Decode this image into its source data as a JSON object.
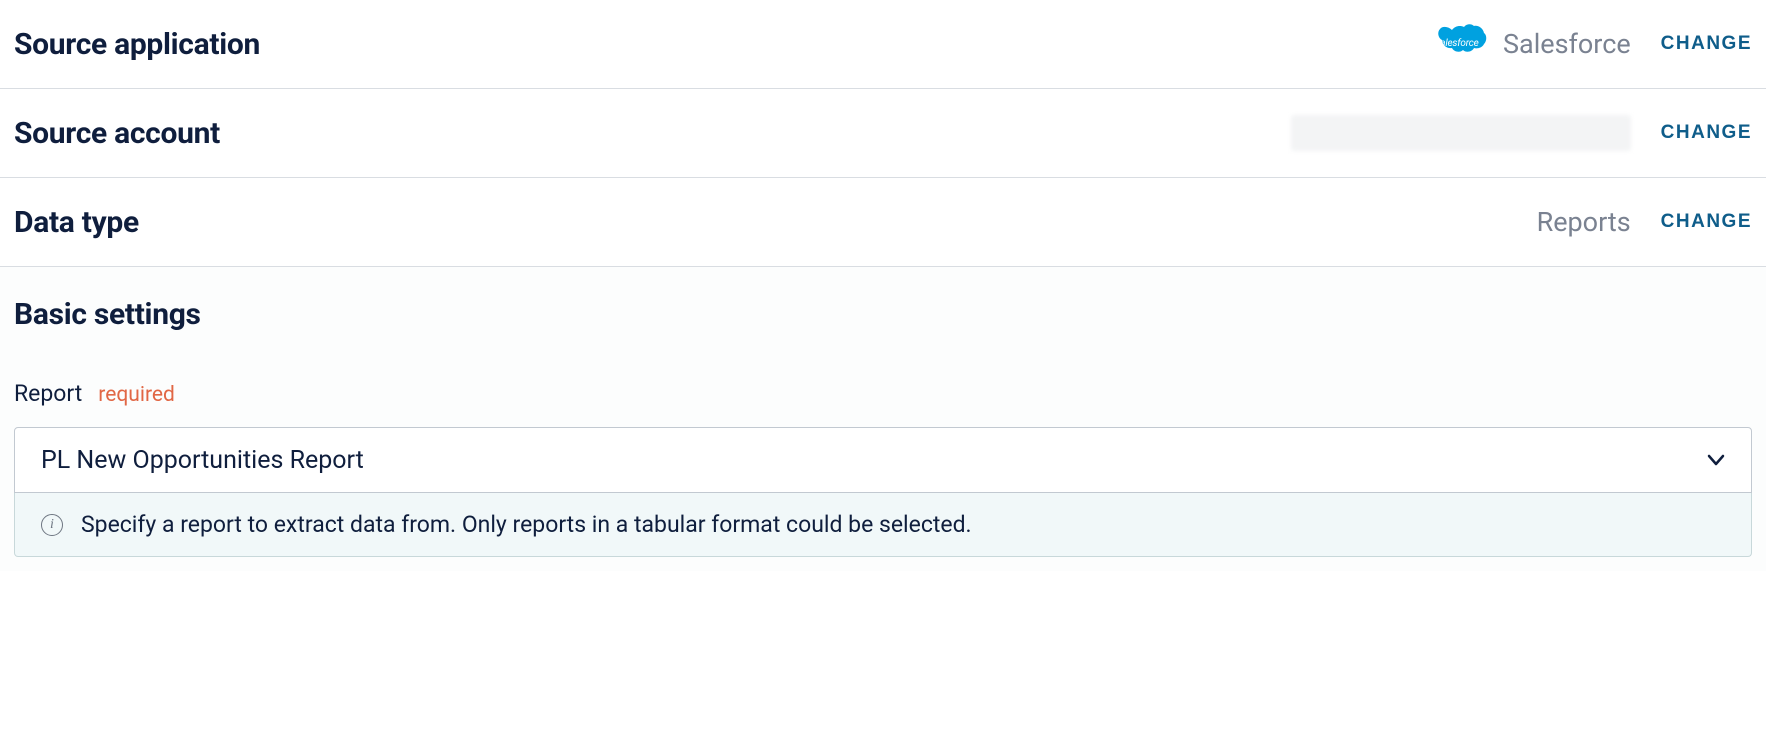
{
  "sections": {
    "source_application": {
      "title": "Source application",
      "value": "Salesforce",
      "logo_label": "salesforce",
      "change_label": "CHANGE"
    },
    "source_account": {
      "title": "Source account",
      "change_label": "CHANGE"
    },
    "data_type": {
      "title": "Data type",
      "value": "Reports",
      "change_label": "CHANGE"
    }
  },
  "basic_settings": {
    "title": "Basic settings",
    "report_field": {
      "label": "Report",
      "required_text": "required",
      "selected_value": "PL New Opportunities Report",
      "help_text": "Specify a report to extract data from. Only reports in a tabular format could be selected."
    }
  }
}
